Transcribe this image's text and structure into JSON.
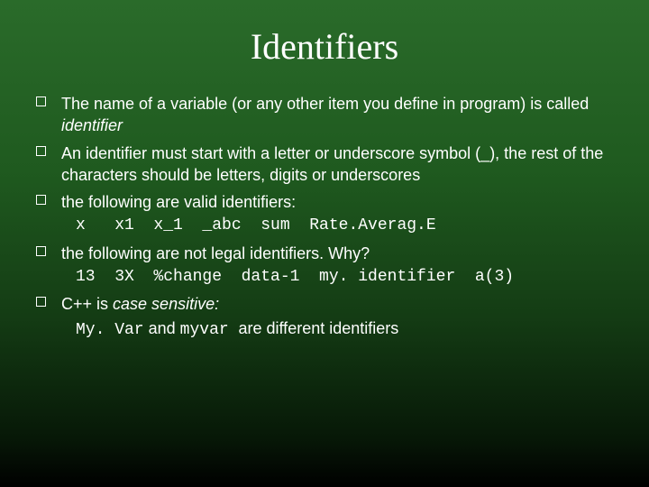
{
  "title": "Identifiers",
  "bullets": {
    "b1_a": "The name of a variable (or any other item you define in program) is called ",
    "b1_b": "identifier",
    "b2": "An identifier must start with a letter or underscore symbol (_), the rest of the characters should be letters, digits or underscores",
    "b3": "the following are valid identifiers:",
    "b3_code": "x   x1  x_1  _abc  sum  Rate.Averag.E",
    "b4": "the following are not legal identifiers. Why?",
    "b4_code": "13  3X  %change  data-1  my. identifier  a(3)",
    "b5_a": "C++ is ",
    "b5_b": "case sensitive:",
    "b5_line_code1": "My. Var",
    "b5_line_mid": " and ",
    "b5_line_code2": "myvar ",
    "b5_line_end": " are different identifiers"
  }
}
